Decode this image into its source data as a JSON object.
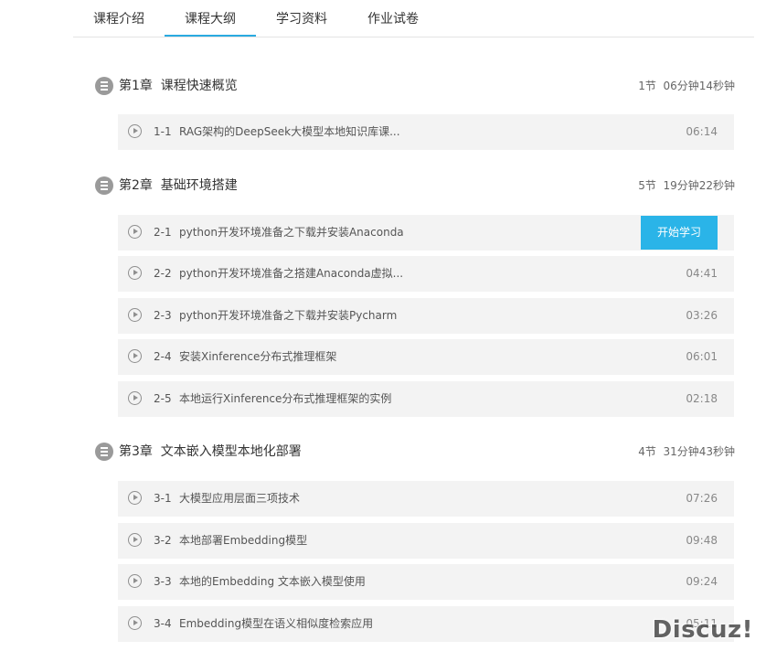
{
  "tabs": [
    {
      "label": "课程介绍",
      "active": false
    },
    {
      "label": "课程大纲",
      "active": true
    },
    {
      "label": "学习资料",
      "active": false
    },
    {
      "label": "作业试卷",
      "active": false
    }
  ],
  "accent_color": "#2ab4e8",
  "chapters": [
    {
      "title": "第1章  课程快速概览",
      "meta": "1节  06分钟14秒钟",
      "lessons": [
        {
          "num": "1-1",
          "title": "RAG架构的DeepSeek大模型本地知识库课...",
          "duration": "06:14"
        }
      ]
    },
    {
      "title": "第2章  基础环境搭建",
      "meta": "5节  19分钟22秒钟",
      "lessons": [
        {
          "num": "2-1",
          "title": "python开发环境准备之下载并安装Anaconda",
          "duration": "",
          "button": "开始学习"
        },
        {
          "num": "2-2",
          "title": "python开发环境准备之搭建Anaconda虚拟...",
          "duration": "04:41"
        },
        {
          "num": "2-3",
          "title": "python开发环境准备之下载并安装Pycharm",
          "duration": "03:26"
        },
        {
          "num": "2-4",
          "title": "安装Xinference分布式推理框架",
          "duration": "06:01"
        },
        {
          "num": "2-5",
          "title": "本地运行Xinference分布式推理框架的实例",
          "duration": "02:18"
        }
      ]
    },
    {
      "title": "第3章  文本嵌入模型本地化部署",
      "meta": "4节  31分钟43秒钟",
      "lessons": [
        {
          "num": "3-1",
          "title": "大模型应用层面三项技术",
          "duration": "07:26"
        },
        {
          "num": "3-2",
          "title": "本地部署Embedding模型",
          "duration": "09:48"
        },
        {
          "num": "3-3",
          "title": "本地的Embedding 文本嵌入模型使用",
          "duration": "09:24"
        },
        {
          "num": "3-4",
          "title": "Embedding模型在语义相似度检索应用",
          "duration": "05:11"
        }
      ]
    }
  ],
  "watermark": "Discuz!"
}
